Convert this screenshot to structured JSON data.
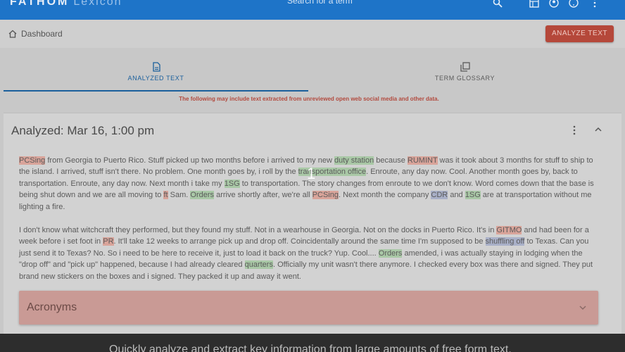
{
  "app": {
    "logo": "FATHOM",
    "logo_sub": "Lexicon"
  },
  "search": {
    "placeholder": "Search for a term"
  },
  "icons": {
    "search": "search-icon",
    "table": "table-icon",
    "account": "account-circle-icon",
    "help": "help-icon",
    "more": "more-vert-icon",
    "home": "home-icon"
  },
  "breadcrumb": {
    "label": "Dashboard"
  },
  "analyze_button": {
    "label": "ANALYZE TEXT"
  },
  "tabs": [
    {
      "label": "ANALYZED TEXT",
      "active": true
    },
    {
      "label": "TERM GLOSSARY",
      "active": false
    }
  ],
  "disclaimer": "The following may include text extracted from unreviewed open web social media and other data.",
  "card": {
    "title": "Analyzed: Mar 16, 1:00 pm"
  },
  "paragraph1": {
    "t1": "PCSing",
    "t2": " from Georgia to Puerto Rico. Stuff picked up two months before i arrived to my new ",
    "t3": "duty station",
    "t4": " because ",
    "t5": "RUMINT",
    "t6": " was it took about 3 months for stuff to ship to the island. I arrived, stuff isn't there. No problem. One month goes by, i roll by the ",
    "t7": "transportation office",
    "t8": ". Enroute, any day now. Cool. Another month goes by, back to transportation. Enroute, any day now. Next month i take my ",
    "t9": "1SG",
    "t10": " to transportation. The story changes from enroute to we don't know. Word comes down that the base is being shut down and we are all moving to ",
    "t11": "ft",
    "t12": " Sam. ",
    "t13": "Orders",
    "t14": " arrive shortly after, we're all ",
    "t15": "PCSing",
    "t16": ". Next month the company ",
    "t17": "CDR",
    "t18": " and ",
    "t19": "1SG",
    "t20": " are at transportation without me lighting a fire."
  },
  "paragraph2": {
    "t1": "I don't know what witchcraft they performed, but they found my stuff. Not in a wearhouse in Georgia. Not on the docks in Puerto Rico. It's in ",
    "t2": "GITMO",
    "t3": " and had been for a week before i set foot in ",
    "t4": "PR",
    "t5": ". It'll take 12 weeks to arrange pick up and drop off. Coincidentally around the same time I'm supposed to be ",
    "t6": "shuffling off",
    "t7": " to Texas. Can you just send it to Texas? No. So i need to be here to receive it, just to load it back on the truck? Yup. Cool.... ",
    "t8": "Orders",
    "t9": " amended, i was actually staying in lodging when the \"drop off\" and \"pick up\" happened, because I had already cleared ",
    "t10": "quarters",
    "t11": ". Officially my unit wasn't there anymore. I checked every box was there and signed. They put brand new stickers on the boxes and i signed. They packed it up and away it went."
  },
  "acronyms": {
    "title": "Acronyms"
  },
  "overlay": {
    "step": "1"
  },
  "bottom_banner": "Quickly analyze and extract key information from large amounts of free form text.",
  "colors": {
    "appbar": "#1e74c8",
    "accent": "#b5483a",
    "highlight_red": "#d9a49a",
    "highlight_green": "#a9c8a6",
    "highlight_blue": "#a9b0c8"
  }
}
